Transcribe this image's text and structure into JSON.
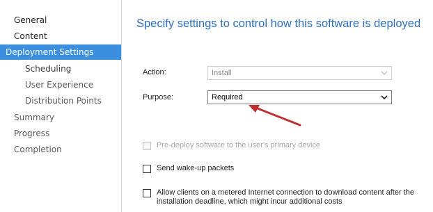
{
  "nav": {
    "items": [
      {
        "label": "General"
      },
      {
        "label": "Content"
      },
      {
        "label": "Deployment Settings"
      },
      {
        "label": "Scheduling"
      },
      {
        "label": "User Experience"
      },
      {
        "label": "Distribution Points"
      },
      {
        "label": "Summary"
      },
      {
        "label": "Progress"
      },
      {
        "label": "Completion"
      }
    ],
    "active_index": 2
  },
  "main": {
    "heading": "Specify settings to control how this software is deployed",
    "action": {
      "label": "Action:",
      "value": "Install",
      "enabled": false
    },
    "purpose": {
      "label": "Purpose:",
      "value": "Required",
      "enabled": true
    },
    "options": [
      {
        "label": "Pre-deploy software to the user's primary device",
        "checked": false,
        "enabled": false
      },
      {
        "label": "Send wake-up packets",
        "checked": false,
        "enabled": true
      },
      {
        "label": "Allow clients on a metered Internet connection to download content after the installation deadline, which might incur additional costs",
        "checked": false,
        "enabled": true
      }
    ]
  },
  "colors": {
    "nav_active_bg": "#3c8fdf",
    "heading": "#2e6fbe",
    "arrow": "#c0302f"
  },
  "icons": {
    "dropdown": "chevron-down-icon",
    "annotation": "red-arrow-icon"
  }
}
